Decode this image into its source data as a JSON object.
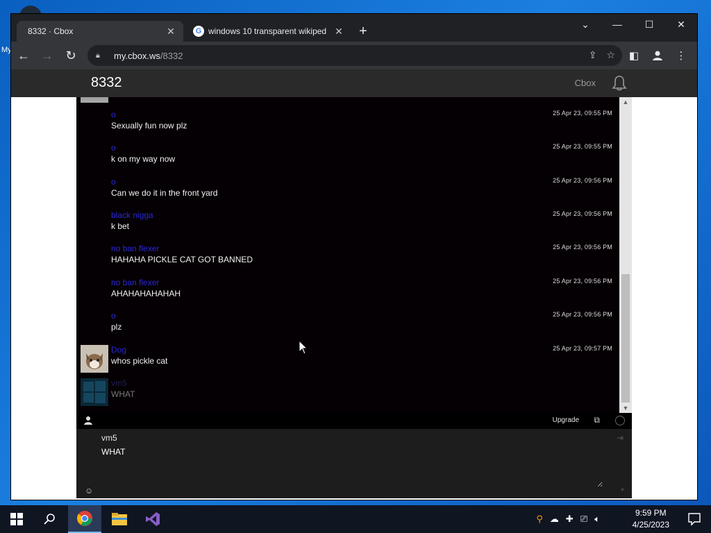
{
  "desktop": {
    "icon_label": "My"
  },
  "browser": {
    "tabs": [
      {
        "title": "8332 · Cbox",
        "active": true
      },
      {
        "title": "windows 10 transparent wikiped",
        "active": false
      }
    ],
    "url_host": "my.cbox.ws",
    "url_path": "/8332"
  },
  "cbox": {
    "title": "8332",
    "link": "Cbox",
    "messages": [
      {
        "name": "o",
        "text": "Sexually fun now plz",
        "time": "25 Apr 23, 09:55 PM"
      },
      {
        "name": "o",
        "text": "k on my way now",
        "time": "25 Apr 23, 09:55 PM"
      },
      {
        "name": "o",
        "text": "Can we do it in the front yard",
        "time": "25 Apr 23, 09:56 PM"
      },
      {
        "name": "black nigga",
        "text": "k bet",
        "time": "25 Apr 23, 09:56 PM"
      },
      {
        "name": "no ban flexer",
        "text": "HAHAHA PICKLE CAT GOT BANNED",
        "time": "25 Apr 23, 09:56 PM"
      },
      {
        "name": "no ban flexer",
        "text": "AHAHAHAHAHAH",
        "time": "25 Apr 23, 09:56 PM"
      },
      {
        "name": "o",
        "text": "plz",
        "time": "25 Apr 23, 09:56 PM"
      },
      {
        "name": "Dog",
        "text": "whos pickle cat",
        "time": "25 Apr 23, 09:57 PM"
      },
      {
        "name": "vm5",
        "text": "WHAT",
        "time": ""
      }
    ],
    "upgrade": "Upgrade",
    "compose": {
      "name": "vm5",
      "message": "WHAT"
    }
  },
  "taskbar": {
    "time": "9:59 PM",
    "date": "4/25/2023"
  },
  "colors": {
    "accent": "#76b9ed",
    "username": "#2a28d6"
  }
}
